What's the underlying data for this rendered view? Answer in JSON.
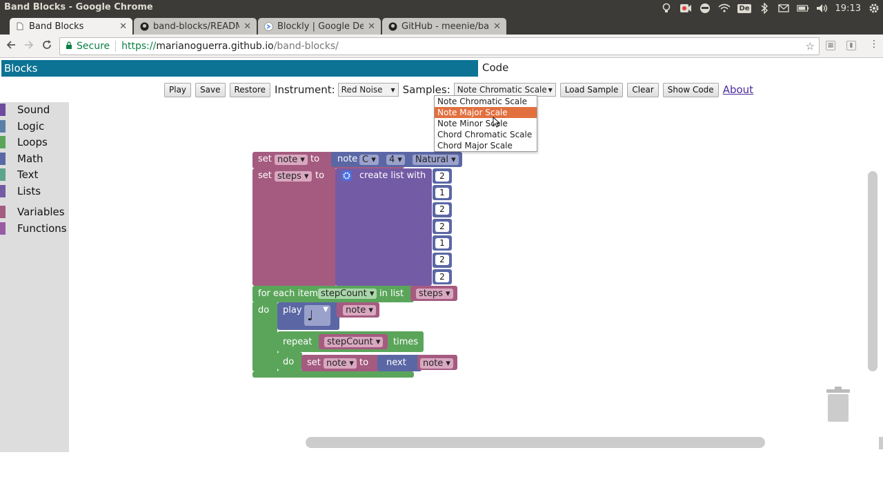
{
  "window": {
    "title": "Band Blocks - Google Chrome"
  },
  "tray": {
    "de_badge": "De",
    "clock": "19:13"
  },
  "tabs": [
    {
      "label": "Band Blocks",
      "icon": "page-icon"
    },
    {
      "label": "band-blocks/READM",
      "icon": "github-icon"
    },
    {
      "label": "Blockly | Google De",
      "icon": "blockly-icon"
    },
    {
      "label": "GitHub - meenie/ban",
      "icon": "github-icon"
    }
  ],
  "address": {
    "secure_label": "Secure",
    "url_scheme": "https://",
    "url_host": "marianoguerra.github.io",
    "url_path": "/band-blocks/"
  },
  "headers": {
    "blocks": "Blocks",
    "code": "Code"
  },
  "controls": {
    "play": "Play",
    "save": "Save",
    "restore": "Restore",
    "instrument_label": "Instrument:",
    "instrument_value": "Red Noise",
    "samples_label": "Samples:",
    "samples_value": "Note Chromatic Scale",
    "load_sample": "Load Sample",
    "clear": "Clear",
    "show_code": "Show Code",
    "about": "About"
  },
  "samples_options": [
    "Note Chromatic Scale",
    "Note Major Scale",
    "Note Minor Scale",
    "Chord Chromatic Scale",
    "Chord Major Scale"
  ],
  "samples_highlighted": "Note Major Scale",
  "toolbox": [
    {
      "label": "Sound",
      "color": "#6c4b9e"
    },
    {
      "label": "Logic",
      "color": "#5b80a5"
    },
    {
      "label": "Loops",
      "color": "#5ba55b"
    },
    {
      "label": "Math",
      "color": "#5b67a5"
    },
    {
      "label": "Text",
      "color": "#5ba58c"
    },
    {
      "label": "Lists",
      "color": "#745ba5"
    },
    {
      "label": "Variables",
      "color": "#a55b80"
    },
    {
      "label": "Functions",
      "color": "#9a5ba5"
    }
  ],
  "blocks": {
    "set1": {
      "set": "set",
      "var": "note",
      "to": "to",
      "note_label": "note",
      "pitch": "C",
      "octave": "4",
      "accidental": "Natural"
    },
    "set2": {
      "set": "set",
      "var": "steps",
      "to": "to",
      "create_list": "create list with",
      "items": [
        "2",
        "1",
        "2",
        "2",
        "1",
        "2",
        "2"
      ]
    },
    "foreach": {
      "for_each": "for each item",
      "var": "stepCount",
      "in_list": "in list",
      "list": "steps",
      "do": "do"
    },
    "play": {
      "play": "play",
      "duration_glyph": "♩",
      "note": "note"
    },
    "repeat": {
      "repeat": "repeat",
      "count": "stepCount",
      "times": "times",
      "do": "do"
    },
    "set3": {
      "set": "set",
      "var": "note",
      "to": "to",
      "next": "next",
      "note": "note"
    }
  },
  "colors": {
    "header": "#0c7394",
    "variables": "#a55b80",
    "lists": "#745ba5",
    "loops": "#5ba55b",
    "math": "#5b67a5",
    "highlight": "#e2703f"
  }
}
